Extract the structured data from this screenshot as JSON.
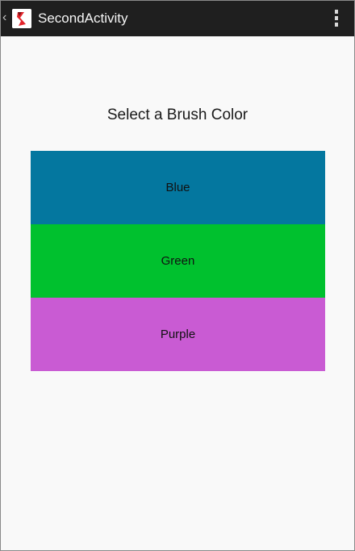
{
  "action_bar": {
    "title": "SecondActivity",
    "back_glyph": "‹",
    "icons": {
      "back": "chevron-left-icon",
      "app": "app-logo-icon",
      "overflow": "overflow-menu-icon"
    },
    "background_color": "#1f1f1f"
  },
  "main": {
    "prompt": "Select a Brush Color",
    "choices": [
      {
        "label": "Blue",
        "color": "#04779f"
      },
      {
        "label": "Green",
        "color": "#00c12e"
      },
      {
        "label": "Purple",
        "color": "#c95bd3"
      }
    ],
    "background_color": "#f9f9f9"
  }
}
